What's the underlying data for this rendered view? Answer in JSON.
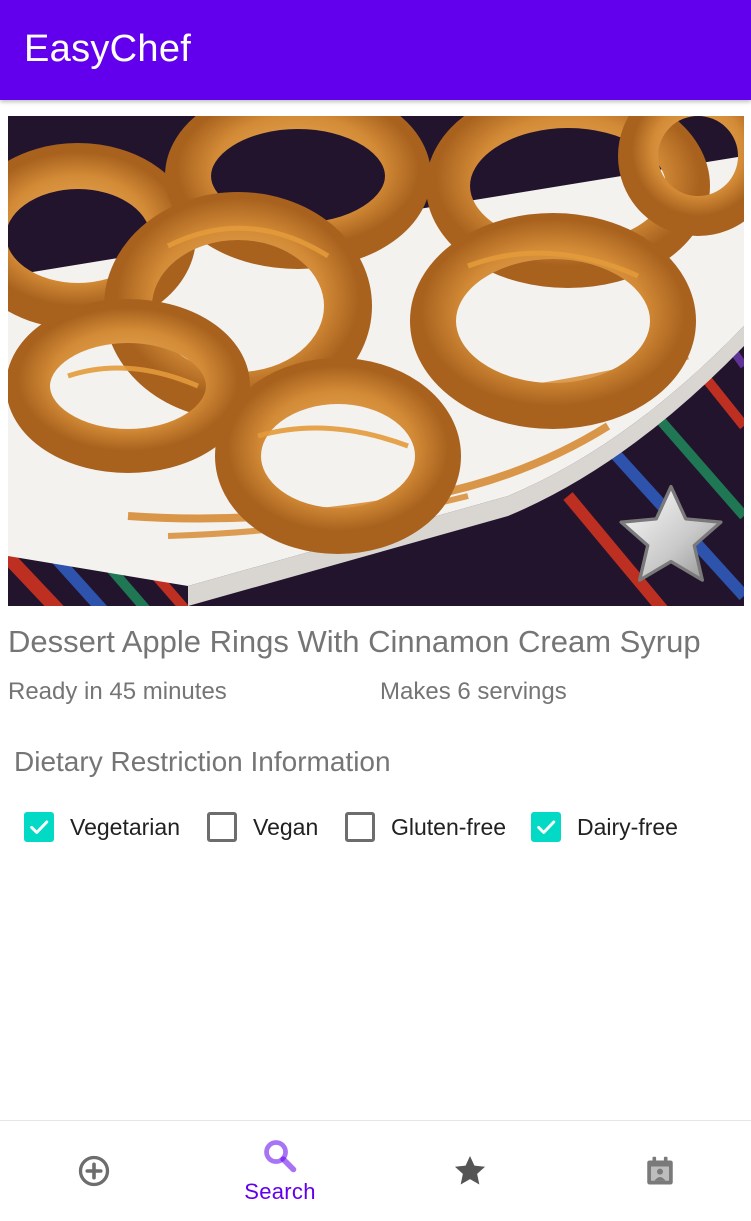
{
  "app": {
    "title": "EasyChef"
  },
  "recipe": {
    "title": "Dessert Apple Rings With Cinnamon Cream Syrup",
    "ready_text": "Ready in 45 minutes",
    "servings_text": "Makes 6 servings",
    "favorite_icon": "star-icon"
  },
  "dietary": {
    "heading": "Dietary Restriction Information",
    "items": [
      {
        "label": "Vegetarian",
        "checked": true
      },
      {
        "label": "Vegan",
        "checked": false
      },
      {
        "label": "Gluten-free",
        "checked": false
      },
      {
        "label": "Dairy-free",
        "checked": true
      }
    ]
  },
  "bottom_nav": {
    "items": [
      {
        "icon": "add-circle-icon",
        "label": "",
        "active": false
      },
      {
        "icon": "search-icon",
        "label": "Search",
        "active": true
      },
      {
        "icon": "star-icon",
        "label": "",
        "active": false
      },
      {
        "icon": "calendar-icon",
        "label": "",
        "active": false
      }
    ]
  },
  "colors": {
    "primary": "#6200ee",
    "accent": "#03dac5",
    "nav_inactive": "#6d6d6d",
    "nav_active": "#6200ee",
    "secondary_text": "#757575"
  }
}
